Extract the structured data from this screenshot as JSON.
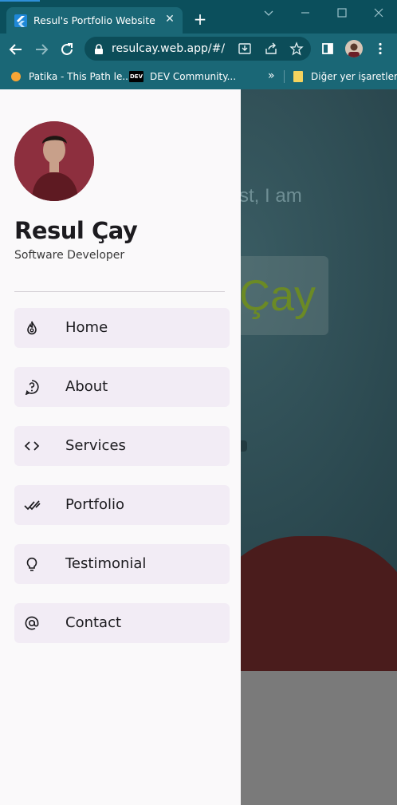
{
  "browser": {
    "tab_title": "Resul's Portfolio Website",
    "url": "resulcay.web.app/#/",
    "bookmarks": [
      {
        "label": "Patika - This Path le..."
      },
      {
        "label": "DEV Community..."
      }
    ],
    "bookmarks_overflow": "»",
    "other_bookmarks": "Diğer yer işaretleri",
    "dev_badge": "DEV"
  },
  "hero": {
    "intro": "st, I am",
    "name_fragment": "Çay"
  },
  "drawer": {
    "name": "Resul Çay",
    "role": "Software Developer",
    "menu": [
      {
        "label": "Home",
        "icon": "flame-icon"
      },
      {
        "label": "About",
        "icon": "help-circle-icon"
      },
      {
        "label": "Services",
        "icon": "code-brackets-icon"
      },
      {
        "label": "Portfolio",
        "icon": "double-check-icon"
      },
      {
        "label": "Testimonial",
        "icon": "lightbulb-icon"
      },
      {
        "label": "Contact",
        "icon": "at-sign-icon"
      }
    ]
  },
  "colors": {
    "titlebar": "#0b4f5c",
    "toolbar": "#1a6776",
    "drawer_bg": "#faf9fa",
    "menu_item_bg": "#f2ecf5",
    "hero_name": "#6b8a25"
  }
}
